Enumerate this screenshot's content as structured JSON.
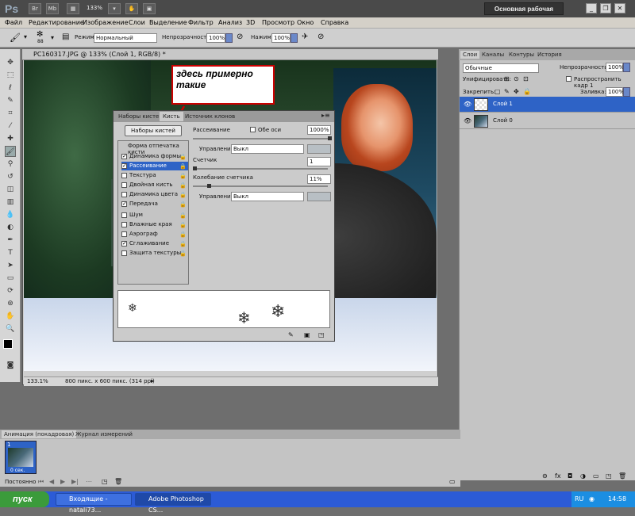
{
  "app": {
    "logo": "Ps",
    "zoom": "133%",
    "workspace_button": "Основная рабочая среда"
  },
  "menu": [
    "Файл",
    "Редактирование",
    "Изображение",
    "Слои",
    "Выделение",
    "Фильтр",
    "Анализ",
    "3D",
    "Просмотр",
    "Окно",
    "Справка"
  ],
  "options": {
    "brush_size": "88",
    "mode_label": "Режим:",
    "mode_value": "Нормальный",
    "opacity_label": "Непрозрачность:",
    "opacity_value": "100%",
    "pressure_label": "Нажим:",
    "pressure_value": "100%"
  },
  "document": {
    "tab_title": "PC160317.JPG @ 133% (Слой 1, RGB/8) *",
    "status_zoom": "133.1%",
    "status_info": "800 пикс. x 600 пикс. (314 ppi)"
  },
  "annotation": {
    "line1": "здесь примерно",
    "line2": "такие"
  },
  "brush_panel": {
    "tabs": [
      "Наборы кистей",
      "Кисть",
      "Источник клонов"
    ],
    "presets_button": "Наборы кистей",
    "section_header": "Форма отпечатка кисти",
    "items": [
      {
        "label": "Динамика формы",
        "checked": true
      },
      {
        "label": "Рассеивание",
        "checked": true
      },
      {
        "label": "Текстура",
        "checked": false
      },
      {
        "label": "Двойная кисть",
        "checked": false
      },
      {
        "label": "Динамика цвета",
        "checked": false
      },
      {
        "label": "Передача",
        "checked": true
      },
      {
        "label": "Шум",
        "checked": false
      },
      {
        "label": "Влажные края",
        "checked": false
      },
      {
        "label": "Аэрограф",
        "checked": false
      },
      {
        "label": "Сглаживание",
        "checked": true
      },
      {
        "label": "Защита текстуры",
        "checked": false
      }
    ],
    "scatter_label": "Рассеивание",
    "both_axes_label": "Обе оси",
    "scatter_value": "1000%",
    "control_label": "Управление:",
    "control_value": "Выкл",
    "count_label": "Счетчик",
    "count_value": "1",
    "count_jitter_label": "Колебание счетчика",
    "count_jitter_value": "11%",
    "control2_label": "Управление:",
    "control2_value": "Выкл"
  },
  "right_panel": {
    "tabs": [
      "Слои",
      "Каналы",
      "Контуры",
      "История"
    ],
    "blend_mode": "Обычные",
    "opacity_label": "Непрозрачность:",
    "opacity_value": "100%",
    "unify_label": "Унифицировать:",
    "propagate_label": "Распространить кадр 1",
    "lock_label": "Закрепить:",
    "fill_label": "Заливка:",
    "fill_value": "100%",
    "layers": [
      {
        "name": "Слой 1",
        "selected": true
      },
      {
        "name": "Слой 0",
        "selected": false
      }
    ]
  },
  "bottom_panel": {
    "tabs": [
      "Анимация (покадровая)",
      "Журнал измерений"
    ],
    "frame_number": "1",
    "frame_delay": "0 сек.",
    "loop_label": "Постоянно"
  },
  "taskbar": {
    "start": "пуск",
    "tasks": [
      "Входящие - natali73...",
      "Adobe Photoshop CS..."
    ],
    "lang": "RU",
    "clock": "14:58"
  },
  "colors": {
    "accent": "#2e63c6",
    "annotation_border": "#cc0000",
    "taskbar": "#2c5bd6"
  }
}
